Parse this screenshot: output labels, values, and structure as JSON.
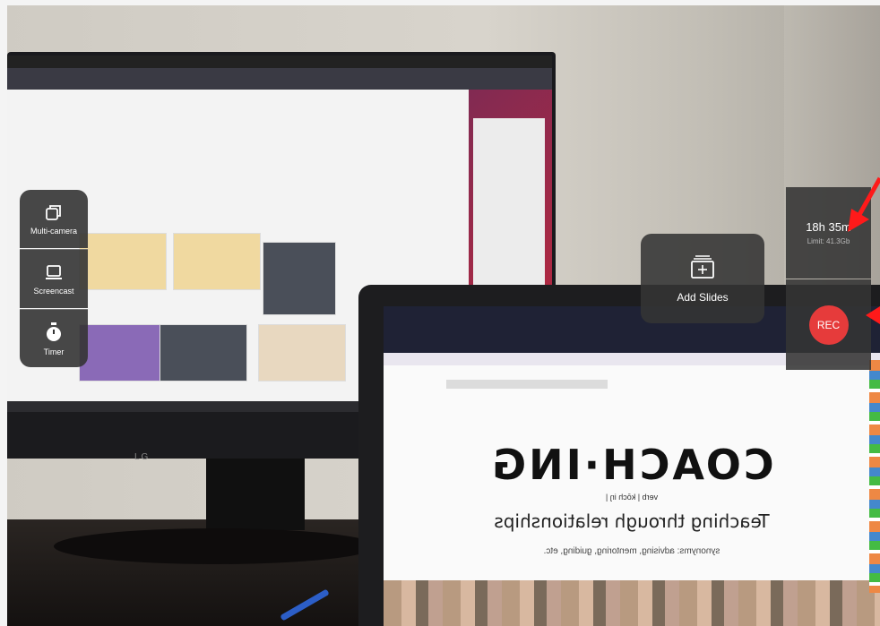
{
  "toolbar": {
    "multi_camera_label": "Multi-camera",
    "screencast_label": "Screencast",
    "timer_label": "Timer"
  },
  "add_slides": {
    "label": "Add Slides"
  },
  "storage": {
    "remaining": "18h 35m",
    "limit": "Limit: 41.3Gb"
  },
  "record": {
    "label": "REC",
    "color": "#e63b3b"
  },
  "annotation": {
    "arrow_color": "#ff1a1a"
  },
  "laptop_page": {
    "headline": "COACH·ING",
    "tagline": "Teaching through relationships",
    "verb": "verb | kōch iŋ |",
    "synonyms": "synonyms: advising, mentoring, guiding, etc."
  },
  "monitor": {
    "brand": "LG"
  },
  "icons": {
    "multi_camera": "multi-camera-icon",
    "screencast": "laptop-icon",
    "timer": "stopwatch-icon",
    "add_slides": "add-slides-icon"
  }
}
